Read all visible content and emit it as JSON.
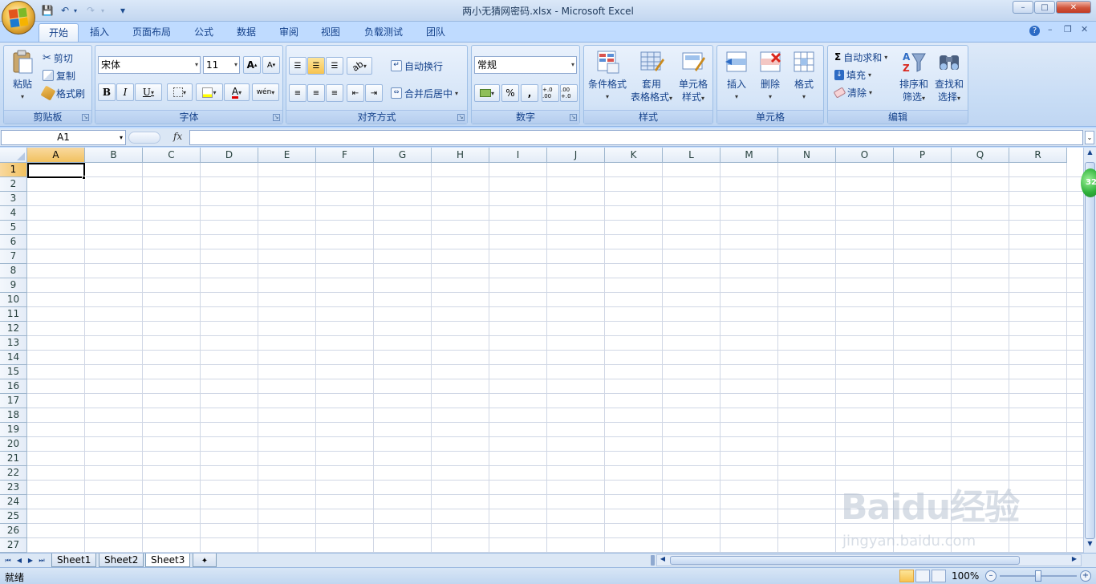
{
  "window": {
    "title": "两小无猜网密码.xlsx - Microsoft Excel",
    "buttons": {
      "minimize": "–",
      "maximize": "□",
      "close": "✕"
    }
  },
  "quick_access": {
    "save": "💾",
    "undo": "↶",
    "redo": "↷",
    "customize": "▾"
  },
  "tabs": [
    {
      "label": "开始",
      "active": true
    },
    {
      "label": "插入"
    },
    {
      "label": "页面布局"
    },
    {
      "label": "公式"
    },
    {
      "label": "数据"
    },
    {
      "label": "审阅"
    },
    {
      "label": "视图"
    },
    {
      "label": "负载测试"
    },
    {
      "label": "团队"
    }
  ],
  "ribbon": {
    "clipboard": {
      "title": "剪贴板",
      "paste": "粘贴",
      "cut": "剪切",
      "copy": "复制",
      "format_painter": "格式刷"
    },
    "font": {
      "title": "字体",
      "font_name": "宋体",
      "font_size": "11",
      "grow": "A",
      "shrink": "A",
      "bold": "B",
      "italic": "I",
      "underline": "U",
      "wen": "wén"
    },
    "alignment": {
      "title": "对齐方式",
      "wrap_text": "自动换行",
      "merge_center": "合并后居中"
    },
    "number": {
      "title": "数字",
      "format": "常规",
      "percent": "%",
      "comma": ",",
      "inc_decimal": "+.0 .00",
      "dec_decimal": ".00 +.0"
    },
    "styles": {
      "title": "样式",
      "conditional": "条件格式",
      "table_format_1": "套用",
      "table_format_2": "表格格式",
      "cell_styles_1": "单元格",
      "cell_styles_2": "样式"
    },
    "cells": {
      "title": "单元格",
      "insert": "插入",
      "delete": "删除",
      "format": "格式"
    },
    "editing": {
      "title": "编辑",
      "autosum": "自动求和",
      "fill": "填充",
      "clear": "清除",
      "sort_1": "排序和",
      "sort_2": "筛选",
      "find_1": "查找和",
      "find_2": "选择"
    }
  },
  "formula_bar": {
    "name_box": "A1",
    "fx": "fx",
    "value": ""
  },
  "columns": [
    "A",
    "B",
    "C",
    "D",
    "E",
    "F",
    "G",
    "H",
    "I",
    "J",
    "K",
    "L",
    "M",
    "N",
    "O",
    "P",
    "Q",
    "R"
  ],
  "rows": [
    "1",
    "2",
    "3",
    "4",
    "5",
    "6",
    "7",
    "8",
    "9",
    "10",
    "11",
    "12",
    "13",
    "14",
    "15",
    "16",
    "17",
    "18",
    "19",
    "20",
    "21",
    "22",
    "23",
    "24",
    "25",
    "26",
    "27"
  ],
  "selected_cell": "A1",
  "sheets": [
    {
      "label": "Sheet1"
    },
    {
      "label": "Sheet2"
    },
    {
      "label": "Sheet3",
      "active": true
    }
  ],
  "status": {
    "ready": "就绪",
    "zoom": "100%",
    "minus": "–",
    "plus": "+"
  },
  "watermark": {
    "brand": "Baidu经验",
    "url": "jingyan.baidu.com"
  },
  "floating_ball": {
    "value": "32"
  },
  "colors": {
    "ribbon_bg": "#c7dcf5",
    "accent_selected": "#f1c15f",
    "grid_line": "#d0d7e5"
  }
}
